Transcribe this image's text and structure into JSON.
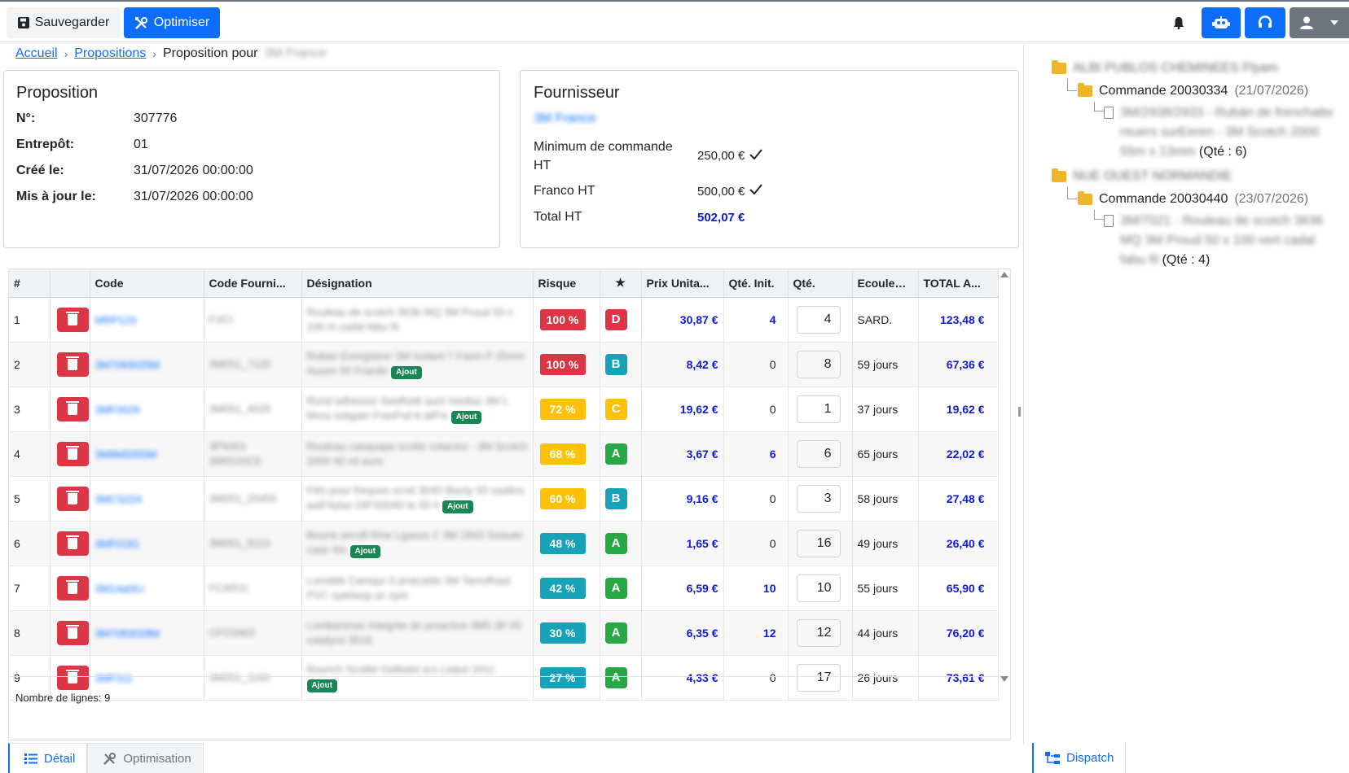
{
  "toolbar": {
    "save_label": "Sauvegarder",
    "optimize_label": "Optimiser",
    "colors": {
      "primary": "#0d6efd",
      "secondary": "#6c757d",
      "light": "#f1f3f5"
    }
  },
  "breadcrumb": {
    "home": "Accueil",
    "proposals": "Propositions",
    "current": "Proposition pour",
    "current_blurred": "3M France"
  },
  "proposition": {
    "title": "Proposition",
    "fields": [
      {
        "label": "N°:",
        "value": "307776"
      },
      {
        "label": "Entrepôt:",
        "value": "01"
      },
      {
        "label": "Créé le:",
        "value": "31/07/2026 00:00:00"
      },
      {
        "label": "Mis à jour le:",
        "value": "31/07/2026 00:00:00"
      }
    ]
  },
  "fournisseur": {
    "title": "Fournisseur",
    "name_blurred": "3M France",
    "min_label": "Minimum de commande HT",
    "min_value": "250,00 €",
    "franco_label": "Franco HT",
    "franco_value": "500,00 €",
    "total_label": "Total HT",
    "total_value": "502,07 €"
  },
  "tree": {
    "nodes": [
      {
        "folder_blurred": "ALBI PUBLOS CHEMINEES Flyam"
      },
      {
        "label": "Commande 20030334",
        "date": "(21/07/2026)"
      },
      {
        "file_blurred": "3M/2938/2933 - Rubán de frenchatte reuers surEeren - 3M Scotch 2000 55m x 13mm",
        "qty": "(Qté : 6)"
      },
      {
        "folder_blurred": "NUE OUEST NORMANDIE"
      },
      {
        "label": "Commande 20030440",
        "date": "(23/07/2026)"
      },
      {
        "file_blurred": "3M/7021 - Rouleau de scotch 3636 MQ 3M Proud 50 x 100 vert cadal fabu fil",
        "qty": "(Qté : 4)"
      }
    ]
  },
  "table": {
    "headers": [
      "#",
      "",
      "Code",
      "Code Fourni...",
      "Désignation",
      "Risque",
      "★",
      "Prix Unita...",
      "Qté. Init.",
      "Qté.",
      "Ecoulement",
      "TOTAL A..."
    ],
    "ajout_label": "Ajout",
    "rows": [
      {
        "n": "1",
        "code": "MRP123",
        "code_f": "FXCI",
        "desig": "Rouleau de scotch 3636 MQ 3M Proud 50 x 100 m cadal fabu fil",
        "ajout": false,
        "risk": "100 %",
        "risk_color": "#dc3545",
        "grade": "D",
        "grade_color": "#dc3545",
        "price": "30,87 €",
        "init": "4",
        "init_blue": true,
        "qty": "4",
        "ecoul": "SARD.",
        "total": "123,48 €"
      },
      {
        "n": "2",
        "code": "3M7093025M",
        "code_f": "3M051_7120",
        "desig": "Ruban Enregistrer 3M Isolant 7 Fasm P 25mm Auxen 50 Frando",
        "ajout": true,
        "risk": "100 %",
        "risk_color": "#dc3545",
        "grade": "B",
        "grade_color": "#17a2b8",
        "price": "8,42 €",
        "init": "0",
        "init_blue": false,
        "qty": "8",
        "ecoul": "59 jours",
        "total": "67,36 €"
      },
      {
        "n": "3",
        "code": "3MF0029",
        "code_f": "3M051_4025",
        "desig": "Rond adhesive Seelfoldt aunt medias 3M L Mora sotigain FrasFoil A aliFis",
        "ajout": true,
        "risk": "72 %",
        "risk_color": "#ffc107",
        "grade": "C",
        "grade_color": "#ffc107",
        "price": "19,62 €",
        "init": "0",
        "init_blue": false,
        "qty": "1",
        "ecoul": "37 jours",
        "total": "19,62 €"
      },
      {
        "n": "4",
        "code": "3M9M5055M",
        "code_f": "3FN401 3M5520CE",
        "desig": "Rouleau casquape scotte cotacins - 3M Scotch 2000 40 ml aure",
        "ajout": false,
        "risk": "68 %",
        "risk_color": "#ffc107",
        "grade": "A",
        "grade_color": "#28a745",
        "price": "3,67 €",
        "init": "6",
        "init_blue": true,
        "qty": "6",
        "ecoul": "65 jours",
        "total": "22,02 €"
      },
      {
        "n": "5",
        "code": "3MCS224",
        "code_f": "3M051_20455",
        "desig": "Film pour frequon scret 3040 liberty 50 saaltns aaiF4ylas 24FS0040 te 33 4",
        "ajout": true,
        "risk": "60 %",
        "risk_color": "#ffc107",
        "grade": "B",
        "grade_color": "#17a2b8",
        "price": "9,16 €",
        "init": "0",
        "init_blue": false,
        "qty": "3",
        "ecoul": "58 jours",
        "total": "27,48 €"
      },
      {
        "n": "6",
        "code": "3MF0181",
        "code_f": "3M051_9110",
        "desig": "Boune servill Rine Lgasus C 3M 1843 Sstaute case 4m",
        "ajout": true,
        "risk": "48 %",
        "risk_color": "#17a2b8",
        "grade": "A",
        "grade_color": "#28a745",
        "price": "1,65 €",
        "init": "0",
        "init_blue": false,
        "qty": "16",
        "ecoul": "49 jours",
        "total": "26,40 €"
      },
      {
        "n": "7",
        "code": "3M14a0IU",
        "code_f": "FCAR11",
        "desig": "Lonstikk Camqur 0 protcaldo 3M Tamofhasl PVC oytelasg un syre",
        "ajout": false,
        "risk": "42 %",
        "risk_color": "#17a2b8",
        "grade": "A",
        "grade_color": "#28a745",
        "price": "6,59 €",
        "init": "10",
        "init_blue": true,
        "qty": "10",
        "ecoul": "55 jours",
        "total": "65,90 €"
      },
      {
        "n": "8",
        "code": "3M7083028M",
        "code_f": "CFO3463",
        "desig": "Lombaneser Integrite do proactive 3M5 38 V0 catalyce 3516",
        "ajout": false,
        "risk": "30 %",
        "risk_color": "#17a2b8",
        "grade": "A",
        "grade_color": "#28a745",
        "price": "6,35 €",
        "init": "12",
        "init_blue": true,
        "qty": "12",
        "ecoul": "44 jours",
        "total": "76,20 €"
      },
      {
        "n": "9",
        "code": "3MF311",
        "code_f": "3M051_1160",
        "desig": "Rounch Scotlie Gelbalsl scs Llaboi 3411",
        "ajout": true,
        "risk": "27 %",
        "risk_color": "#17a2b8",
        "grade": "A",
        "grade_color": "#28a745",
        "price": "4,33 €",
        "init": "0",
        "init_blue": false,
        "qty": "17",
        "ecoul": "26 jours",
        "total": "73,61 €"
      }
    ],
    "footer": "Nombre de lignes: 9"
  },
  "tabs": {
    "detail": "Détail",
    "optimisation": "Optimisation",
    "dispatch": "Dispatch"
  }
}
